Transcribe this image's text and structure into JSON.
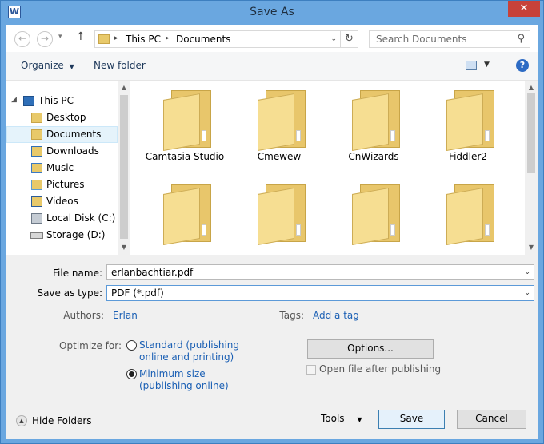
{
  "window": {
    "title": "Save As",
    "app_icon_letter": "W",
    "close_glyph": "✕"
  },
  "nav": {
    "back_glyph": "←",
    "forward_glyph": "→",
    "history_glyph": "▾",
    "up_glyph": "↑",
    "address": [
      "This PC",
      "Documents"
    ],
    "address_sep": "▸",
    "address_dropdown_glyph": "⌄",
    "refresh_glyph": "↻",
    "search_placeholder": "Search Documents",
    "search_glyph": "⚲"
  },
  "toolbar": {
    "organize": "Organize",
    "organize_arrow": "▼",
    "new_folder": "New folder",
    "view_arrow": "▼",
    "help_glyph": "?"
  },
  "tree": {
    "root": "This PC",
    "items": [
      {
        "label": "Desktop",
        "icon": "desktop-folder-icon"
      },
      {
        "label": "Documents",
        "icon": "documents-folder-icon",
        "selected": true
      },
      {
        "label": "Downloads",
        "icon": "downloads-folder-icon"
      },
      {
        "label": "Music",
        "icon": "music-folder-icon"
      },
      {
        "label": "Pictures",
        "icon": "pictures-folder-icon"
      },
      {
        "label": "Videos",
        "icon": "videos-folder-icon"
      },
      {
        "label": "Local Disk (C:)",
        "icon": "local-disk-icon"
      },
      {
        "label": "Storage (D:)",
        "icon": "drive-icon"
      }
    ],
    "expander_glyph": "◢",
    "scroll_up": "▲",
    "scroll_down": "▼"
  },
  "folders": [
    "Camtasia Studio",
    "Cmewew",
    "CnWizards",
    "Fiddler2"
  ],
  "form": {
    "file_name_label": "File name:",
    "file_name_value": "erlanbachtiar.pdf",
    "save_type_label": "Save as type:",
    "save_type_value": "PDF (*.pdf)",
    "dropdown_glyph": "⌄",
    "authors_label": "Authors:",
    "authors_value": "Erlan",
    "tags_label": "Tags:",
    "tags_value": "Add a tag",
    "optimize_label": "Optimize for:",
    "optimize_standard": [
      "Standard (publishing",
      "online and printing)"
    ],
    "optimize_minimum": [
      "Minimum size",
      "(publishing online)"
    ],
    "options_button": "Options...",
    "open_after_label": "Open file after publishing",
    "hide_folders": "Hide Folders",
    "hide_glyph": "▲",
    "tools": "Tools",
    "tools_arrow": "▼",
    "save_button": "Save",
    "cancel_button": "Cancel"
  }
}
